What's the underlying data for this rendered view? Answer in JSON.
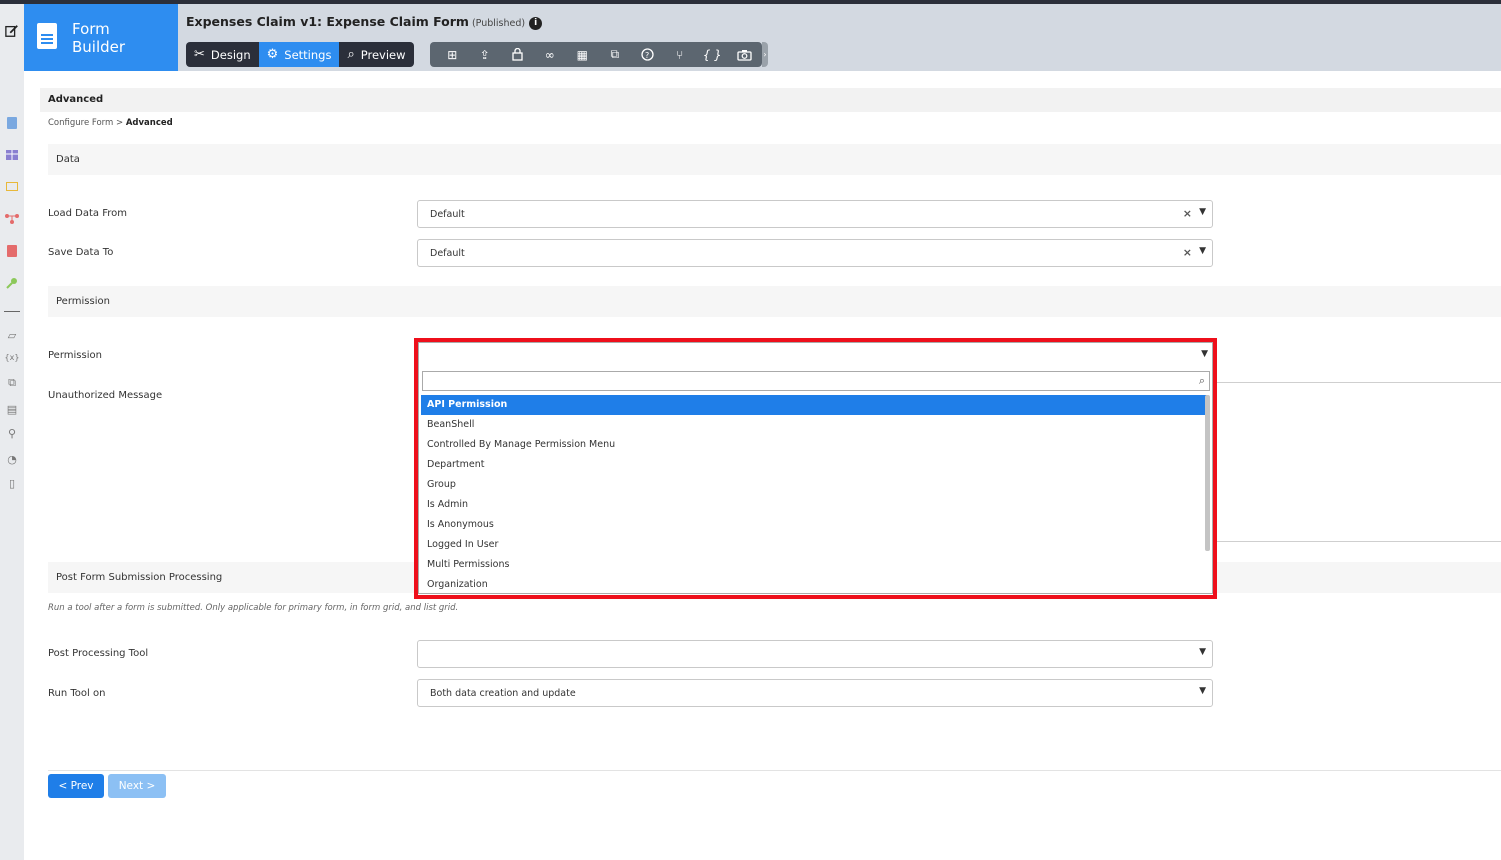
{
  "brand": {
    "line1": "Form",
    "line2": "Builder"
  },
  "header": {
    "title": "Expenses Claim v1: Expense Claim Form",
    "status": "(Published)",
    "info_icon": "info-icon"
  },
  "modes": [
    {
      "label": "Design",
      "icon": "design-tools-icon"
    },
    {
      "label": "Settings",
      "icon": "gear-icon"
    },
    {
      "label": "Preview",
      "icon": "preview-icon"
    }
  ],
  "toolbar_icons": [
    "sitemap-icon",
    "upload-icon",
    "lock-icon",
    "binoculars-icon",
    "table-icon",
    "translate-icon",
    "help-icon",
    "branch-icon",
    "braces-icon",
    "camera-icon"
  ],
  "page": {
    "header": "Advanced",
    "breadcrumb": {
      "parent": "Configure Form",
      "separator": ">",
      "current": "Advanced"
    }
  },
  "sections": {
    "data": "Data",
    "permission": "Permission",
    "post": "Post Form Submission Processing"
  },
  "fields": {
    "load_label": "Load Data From",
    "load_value": "Default",
    "save_label": "Save Data To",
    "save_value": "Default",
    "permission_label": "Permission",
    "permission_value": "",
    "unauth_label": "Unauthorized Message",
    "post_note": "Run a tool after a form is submitted. Only applicable for primary form, in form grid, and list grid.",
    "tool_label": "Post Processing Tool",
    "tool_value": "",
    "run_label": "Run Tool on",
    "run_value": "Both data creation and update"
  },
  "dropdown": {
    "search_value": "",
    "items": [
      "API Permission",
      "BeanShell",
      "Controlled By Manage Permission Menu",
      "Department",
      "Group",
      "Is Admin",
      "Is Anonymous",
      "Logged In User",
      "Multi Permissions",
      "Organization"
    ],
    "selected_index": 0
  },
  "buttons": {
    "prev": "< Prev",
    "next": "Next >"
  },
  "colors": {
    "brand": "#2e8df0",
    "highlight": "#ee0f1b",
    "selected": "#1f7ee8"
  }
}
